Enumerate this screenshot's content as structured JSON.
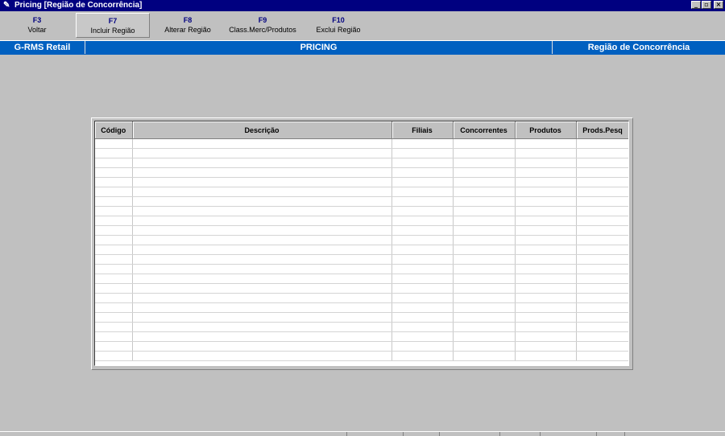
{
  "window": {
    "title": "Pricing  [Região de Concorrência]",
    "buttons": {
      "minimize": "_",
      "restore": "▫",
      "close": "×"
    }
  },
  "toolbar": {
    "keys": [
      {
        "key": "F3",
        "label": "Voltar"
      },
      {
        "key": "F7",
        "label": "Incluir Região"
      },
      {
        "key": "F8",
        "label": "Alterar Região"
      },
      {
        "key": "F9",
        "label": "Class.Merc/Produtos"
      },
      {
        "key": "F10",
        "label": "Exclui Região"
      }
    ]
  },
  "header": {
    "left": "G-RMS Retail",
    "center": "PRICING",
    "right": "Região de Concorrência"
  },
  "grid": {
    "columns": [
      "Código",
      "Descrição",
      "Filiais",
      "Concorrentes",
      "Produtos",
      "Prods.Pesq"
    ]
  },
  "colors": {
    "title_bar": "#000080",
    "header_bar": "#0060c0",
    "background": "#c0c0c0"
  }
}
